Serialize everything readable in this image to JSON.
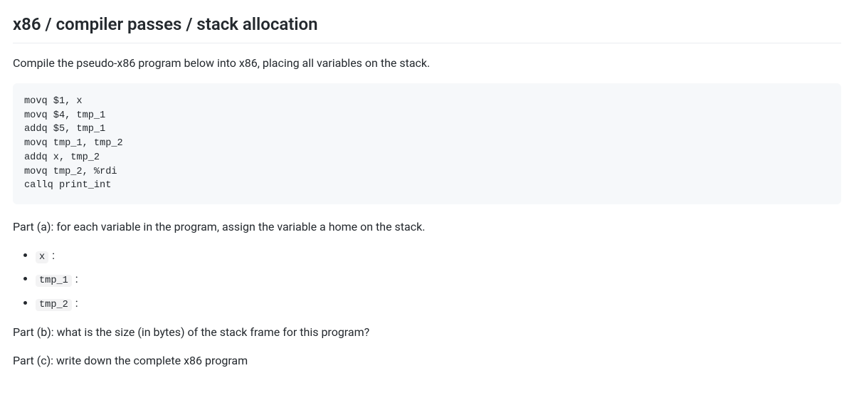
{
  "title": "x86 / compiler passes / stack allocation",
  "intro": "Compile the pseudo-x86 program below into x86, placing all variables on the stack.",
  "code": "movq $1, x\nmovq $4, tmp_1\naddq $5, tmp_1\nmovq tmp_1, tmp_2\naddq x, tmp_2\nmovq tmp_2, %rdi\ncallq print_int",
  "partA": "Part (a): for each variable in the program, assign the variable a home on the stack.",
  "vars": {
    "items": [
      {
        "name": "x",
        "suffix": " :"
      },
      {
        "name": "tmp_1",
        "suffix": " :"
      },
      {
        "name": "tmp_2",
        "suffix": " :"
      }
    ]
  },
  "partB": "Part (b): what is the size (in bytes) of the stack frame for this program?",
  "partC": "Part (c): write down the complete x86 program"
}
